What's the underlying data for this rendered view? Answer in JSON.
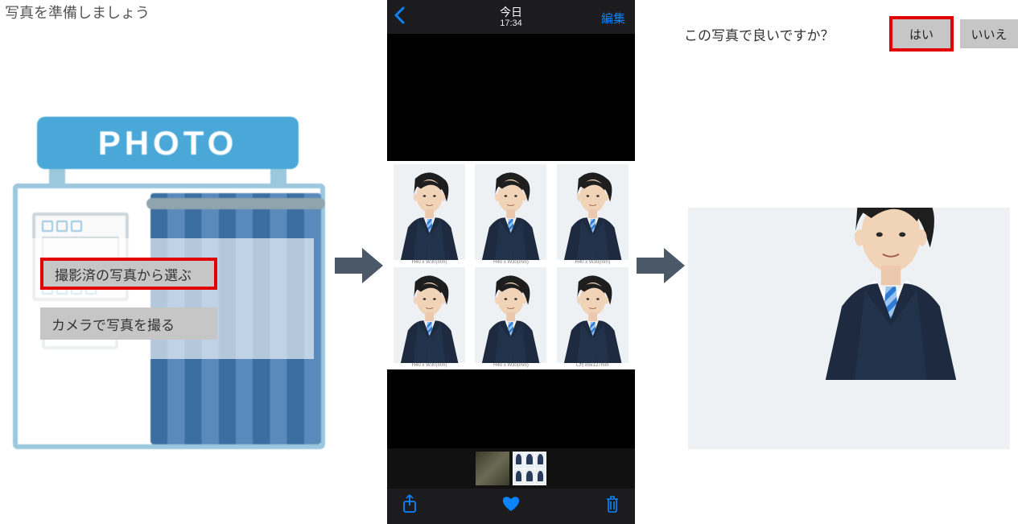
{
  "panel1": {
    "title": "写真を準備しましょう",
    "booth_sign": "PHOTO",
    "button_select": "撮影済の写真から選ぶ",
    "button_camera": "カメラで写真を撮る"
  },
  "panel2": {
    "header_title": "今日",
    "header_time": "17:34",
    "header_edit": "編集",
    "cell_caption_small": "H40 x W30(mm)",
    "cell_caption_large": "L判 89x127mm"
  },
  "panel3": {
    "question": "この写真で良いですか？",
    "yes": "はい",
    "no": "いいえ"
  }
}
